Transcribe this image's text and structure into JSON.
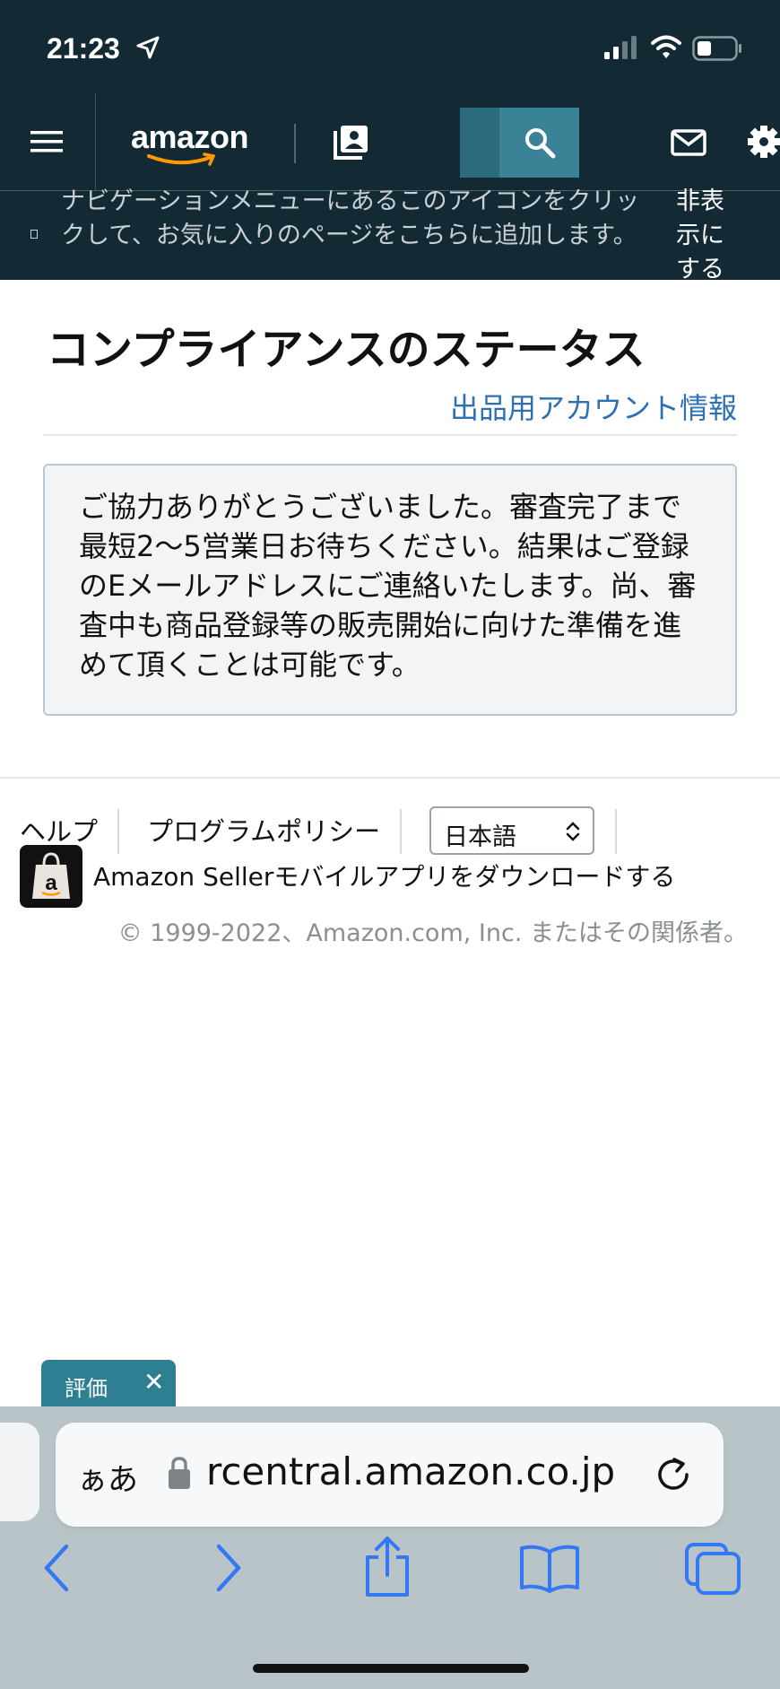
{
  "status_bar": {
    "time": "21:23",
    "location_icon": "location-arrow-icon",
    "signal_icon": "cellular-signal-icon",
    "wifi_icon": "wifi-icon",
    "battery_icon": "battery-icon"
  },
  "nav": {
    "menu_icon": "hamburger-menu-icon",
    "logo_text": "amazon",
    "bookmark_icon": "bookmark-icon",
    "search_icon": "search-icon",
    "mail_icon": "mail-icon",
    "settings_icon": "gear-icon"
  },
  "banner": {
    "message": "ナビゲーションメニューにあるこのアイコンをクリックして、お気に入りのページをこちらに追加します。",
    "hide_label": "非表示にする"
  },
  "main": {
    "title": "コンプライアンスのステータス",
    "account_link": "出品用アカウント情報",
    "notice": "ご協力ありがとうございました。審査完了まで最短2～5営業日お待ちください。結果はご登録のEメールアドレスにご連絡いたします。尚、審査中も商品登録等の販売開始に向けた準備を進めて頂くことは可能です。"
  },
  "footer": {
    "help": "ヘルプ",
    "policy": "プログラムポリシー",
    "language": "日本語",
    "app_link": "Amazon Sellerモバイルアプリをダウンロードする",
    "copyright": "© 1999-2022、Amazon.com, Inc. またはその関係者。"
  },
  "feedback": {
    "label": "評価",
    "close": "✕"
  },
  "safari": {
    "aa_label": "ぁあ",
    "url": "rcentral.amazon.co.jp",
    "colors": {
      "accent": "#3478f6",
      "nav_bg": "#132a34",
      "link": "#2f6fb3"
    }
  }
}
